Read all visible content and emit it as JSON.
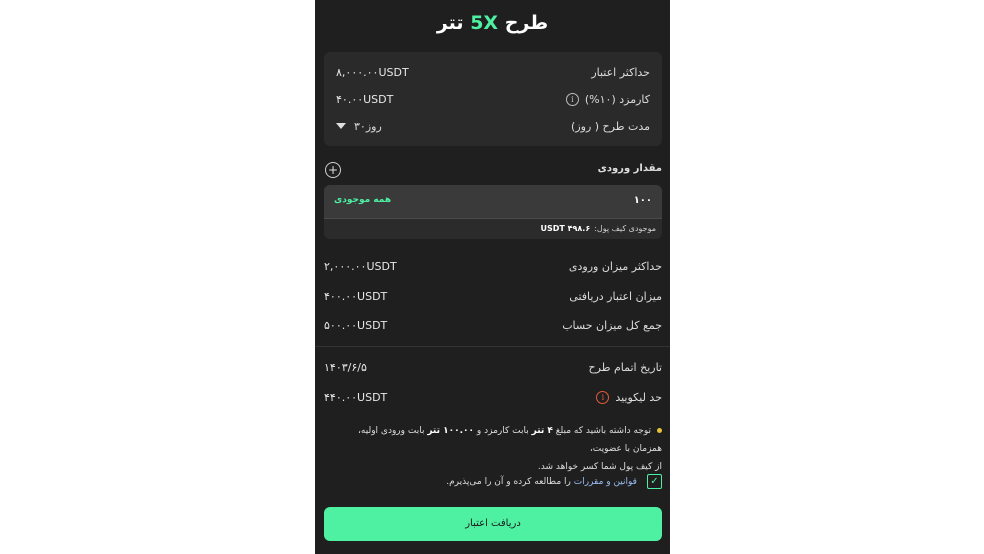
{
  "title": {
    "prefix": "طرح",
    "accent": "5X",
    "suffix": "تتر"
  },
  "card": {
    "max_credit_label": "حداکثر اعتبار",
    "max_credit_value": "۸,۰۰۰.۰۰USDT",
    "fee_label": "کارمزد (۱۰%)",
    "fee_value": "۴۰.۰۰USDT",
    "duration_label": "مدت طرح ( روز)",
    "duration_value": "۳۰روز"
  },
  "input_section": {
    "label": "مقدار ورودی",
    "plus": "+",
    "amount": "۱۰۰",
    "all_balance": "همه موجودی",
    "wallet_label": "موجودی کیف پول:",
    "wallet_value": "۴۹۸.۶ USDT"
  },
  "stats": {
    "max_input_label": "حداکثر میزان ورودی",
    "max_input_value": "۲,۰۰۰.۰۰USDT",
    "received_credit_label": "میزان اعتبار دریافتی",
    "received_credit_value": "۴۰۰.۰۰USDT",
    "total_account_label": "جمع کل میزان حساب",
    "total_account_value": "۵۰۰.۰۰USDT",
    "end_date_label": "تاریخ اتمام طرح",
    "end_date_value": "۱۴۰۳/۶/۵",
    "liquid_label": "حد لیکویید",
    "liquid_value": "۴۴۰.۰۰USDT"
  },
  "note": {
    "part1": "توجه داشته باشید که مبلغ",
    "fee_bold": "۴ تتر",
    "part2": "بابت کارمزد و",
    "input_bold": "۱۰۰.۰۰ تتر",
    "part3": "بابت ورودی اولیه، همزمان با عضویت،",
    "line2": "از کیف پول شما کسر خواهد شد."
  },
  "agree": {
    "link": "قوانین و مقررات",
    "text": "را مطالعه کرده و آن را می‌پذیرم."
  },
  "submit_label": "دریافت اعتبار",
  "colors": {
    "accent": "#4ef0a2",
    "panel": "#1f1f1f",
    "warn": "#e85a3a"
  }
}
